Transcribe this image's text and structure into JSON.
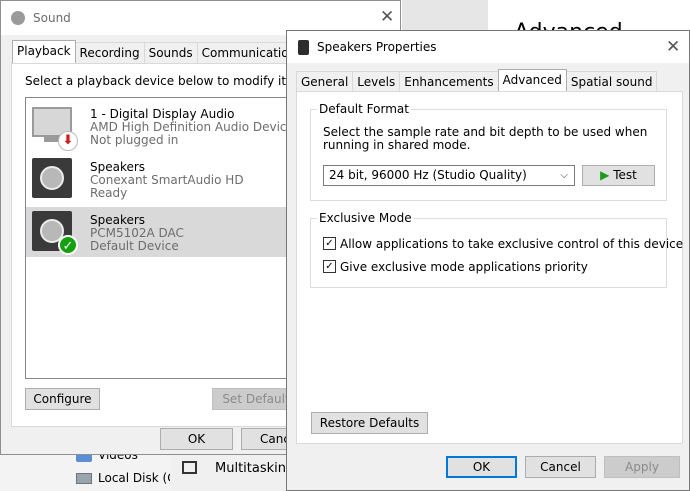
{
  "background": {
    "explorer_items": [
      "Videos",
      "Local Disk (C:"
    ],
    "settings_heading_partial": "Advanced",
    "settings_item": "Multitasking"
  },
  "sound_window": {
    "title": "Sound",
    "tabs": [
      {
        "label": "Playback",
        "active": true
      },
      {
        "label": "Recording",
        "active": false
      },
      {
        "label": "Sounds",
        "active": false
      },
      {
        "label": "Communications",
        "active": false
      }
    ],
    "instruction": "Select a playback device below to modify its setting",
    "devices": [
      {
        "name": "1 - Digital Display Audio",
        "driver": "AMD High Definition Audio Device",
        "status": "Not plugged in",
        "icon": "monitor-icon",
        "badge": "red-down-arrow",
        "selected": false
      },
      {
        "name": "Speakers",
        "driver": "Conexant SmartAudio HD",
        "status": "Ready",
        "icon": "speaker-icon",
        "badge": "",
        "selected": false
      },
      {
        "name": "Speakers",
        "driver": "PCM5102A DAC",
        "status": "Default Device",
        "icon": "speaker-icon",
        "badge": "green-check",
        "selected": true
      }
    ],
    "configure_label": "Configure",
    "set_default_label": "Set Default",
    "ok_label": "OK",
    "cancel_label": "Cance"
  },
  "properties_window": {
    "title": "Speakers Properties",
    "tabs": [
      {
        "label": "General",
        "active": false
      },
      {
        "label": "Levels",
        "active": false
      },
      {
        "label": "Enhancements",
        "active": false
      },
      {
        "label": "Advanced",
        "active": true
      },
      {
        "label": "Spatial sound",
        "active": false
      }
    ],
    "default_format": {
      "heading": "Default Format",
      "description": "Select the sample rate and bit depth to be used when running in shared mode.",
      "selected_format": "24 bit, 96000 Hz (Studio Quality)",
      "test_label": "Test"
    },
    "exclusive_mode": {
      "heading": "Exclusive Mode",
      "options": [
        {
          "label": "Allow applications to take exclusive control of this device",
          "checked": true
        },
        {
          "label": "Give exclusive mode applications priority",
          "checked": true
        }
      ]
    },
    "restore_defaults_label": "Restore Defaults",
    "ok_label": "OK",
    "cancel_label": "Cancel",
    "apply_label": "Apply"
  },
  "colors": {
    "accent": "#0078d7",
    "selected_row": "#d9d9d9",
    "green_check": "#13a10e",
    "red_arrow": "#d01c1c",
    "test_arrow": "#1a9c1a"
  }
}
